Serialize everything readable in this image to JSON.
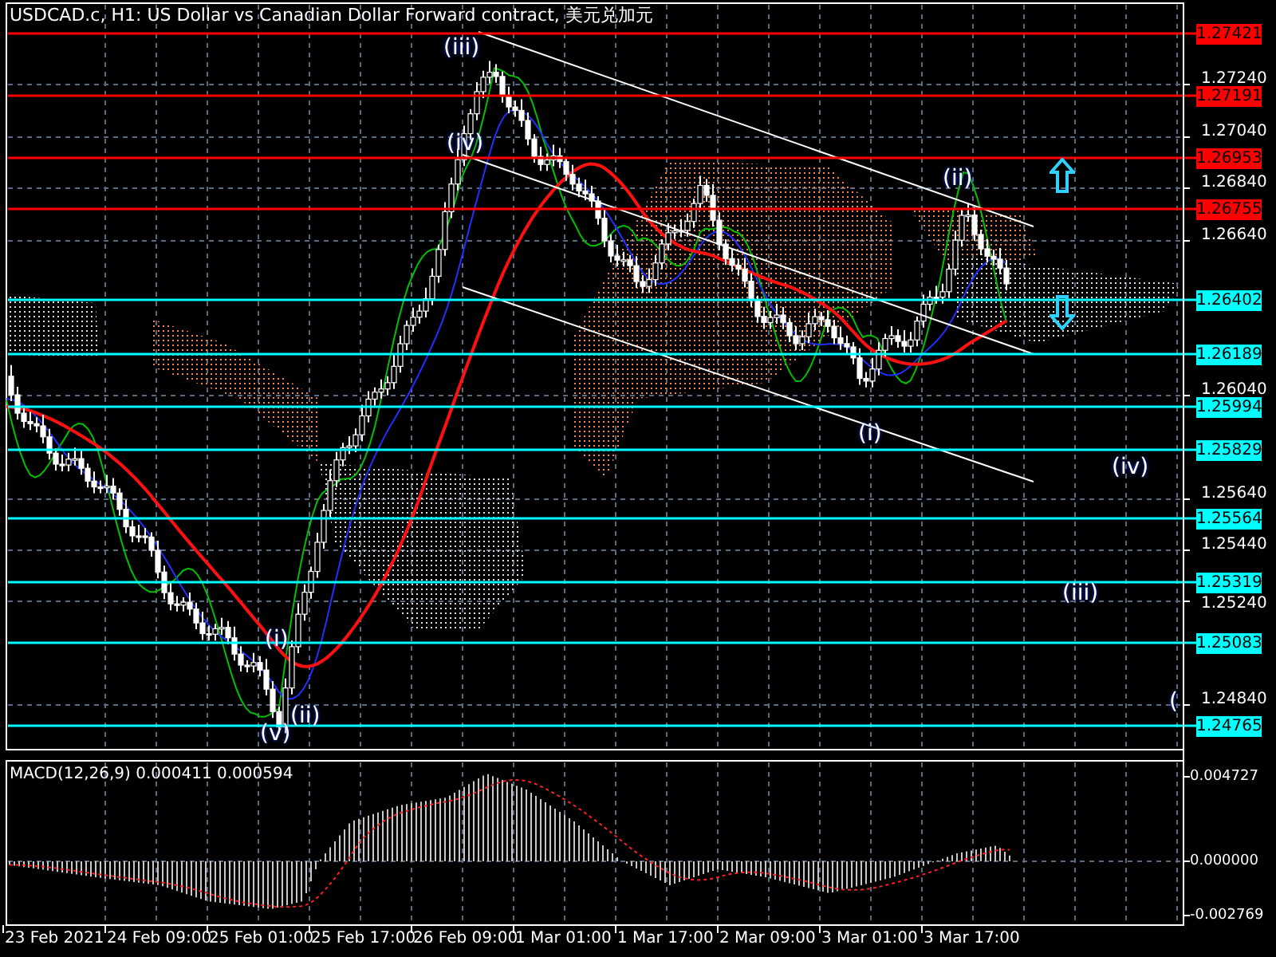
{
  "title": "USDCAD.c, H1:  US Dollar vs Canadian Dollar Forward contract, 美元兑加元",
  "price_axis": {
    "ticks": [
      "1.27240",
      "1.27040",
      "1.26840",
      "1.26640",
      "1.26040",
      "1.25640",
      "1.25440",
      "1.25240",
      "1.24840"
    ],
    "levels": [
      {
        "label": "1.27421",
        "color": "#ff0000"
      },
      {
        "label": "1.27191",
        "color": "#ff0000"
      },
      {
        "label": "1.26953",
        "color": "#ff0000"
      },
      {
        "label": "1.26755",
        "color": "#ff0000"
      },
      {
        "label": "1.26402",
        "color": "#00ffff"
      },
      {
        "label": "1.26189",
        "color": "#00ffff"
      },
      {
        "label": "1.25994",
        "color": "#00ffff"
      },
      {
        "label": "1.25829",
        "color": "#00ffff"
      },
      {
        "label": "1.25564",
        "color": "#00ffff"
      },
      {
        "label": "1.25319",
        "color": "#00ffff"
      },
      {
        "label": "1.25083",
        "color": "#00ffff"
      },
      {
        "label": "1.24765",
        "color": "#00ffff"
      }
    ]
  },
  "wave_labels": [
    "(iii)",
    "(iv)",
    "(ii)",
    "(i)",
    "(iv)",
    "(iii)",
    "(i)",
    "(ii)",
    "(v)",
    "("
  ],
  "indicator": {
    "label": "MACD(12,26,9) 0.000411 0.000594",
    "ticks": [
      "0.004727",
      "0.000000",
      "-0.002769"
    ]
  },
  "time_axis": [
    "23 Feb 2021",
    "24 Feb 09:00",
    "25 Feb 01:00",
    "25 Feb 17:00",
    "26 Feb 09:00",
    "1 Mar 01:00",
    "1 Mar 17:00",
    "2 Mar 09:00",
    "3 Mar 01:00",
    "3 Mar 17:00"
  ]
}
